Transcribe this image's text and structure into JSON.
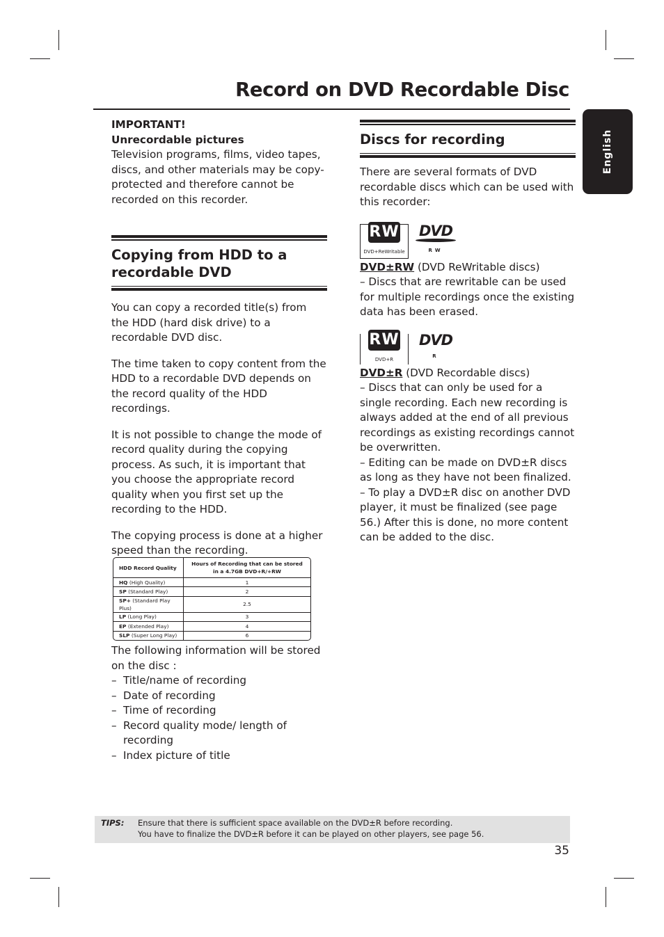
{
  "header": {
    "title": "Record on DVD Recordable Disc"
  },
  "language_tab": "English",
  "left_column": {
    "important_label": "IMPORTANT!",
    "important_subtitle": "Unrecordable pictures",
    "important_text": "Television programs, films, video tapes, discs, and other materials may be copy-protected and therefore cannot be recorded on this recorder.",
    "section_heading": "Copying from HDD to a recordable DVD",
    "paragraphs": [
      "You can copy a recorded title(s) from the HDD (hard disk drive) to a recordable DVD disc.",
      "The time taken to copy content from the HDD to a recordable DVD depends on the record quality of the HDD recordings.",
      "It is not possible to change the mode of record quality during the copying process. As such, it is important that you choose the appropriate record quality when you first set up the recording to the HDD.",
      "The copying process is done at a higher speed than the recording."
    ],
    "table": {
      "headers": [
        "HDD Record Quality",
        "Hours of Recording that can be stored in a 4.7GB DVD+R/+RW"
      ],
      "rows": [
        {
          "code": "HQ",
          "desc": "(High Quality)",
          "hours": "1"
        },
        {
          "code": "SP",
          "desc": "(Standard Play)",
          "hours": "2"
        },
        {
          "code": "SP+",
          "desc": "(Standard Play Plus)",
          "hours": "2.5"
        },
        {
          "code": "LP",
          "desc": "(Long Play)",
          "hours": "3"
        },
        {
          "code": "EP",
          "desc": "(Extended Play)",
          "hours": "4"
        },
        {
          "code": "SLP",
          "desc": "(Super Long Play)",
          "hours": "6"
        }
      ]
    },
    "stored_info_intro": "The following information will be stored on the disc :",
    "stored_info_items": [
      "Title/name of recording",
      "Date of recording",
      "Time of recording",
      "Record quality mode/ length of recording",
      "Index picture of title"
    ]
  },
  "right_column": {
    "section_heading": "Discs for recording",
    "intro": "There are several formats of DVD recordable discs which can be used with this recorder:",
    "discs": [
      {
        "logo_mark": "RW",
        "logo_caption": "DVD+ReWritable",
        "dvd_logo_text": "DVD",
        "dvd_logo_sub": "RW",
        "name": "DVD±RW",
        "name_suffix": " (DVD ReWritable discs)",
        "description": "– Discs that are rewritable can be used for multiple recordings once the existing data has been erased."
      },
      {
        "logo_mark": "RW",
        "logo_caption": "DVD+R",
        "dvd_logo_text": "DVD",
        "dvd_logo_sub": "R",
        "name": "DVD±R",
        "name_suffix": " (DVD Recordable discs)",
        "description_lines": [
          "– Discs that can only be used for a single recording. Each new recording is always added at the end of all previous recordings as existing recordings cannot be overwritten.",
          "– Editing can be made on DVD±R discs as long as they have not been finalized.",
          "– To play a DVD±R disc on another DVD player, it must be finalized (see page 56.) After this is done, no more content can be added to the disc."
        ]
      }
    ]
  },
  "tips": {
    "label": "TIPS:",
    "lines": [
      "Ensure that there is sufficient space available on the DVD±R before recording.",
      "You have to finalize the DVD±R before it can be played on other players, see page 56."
    ]
  },
  "page_number": "35"
}
